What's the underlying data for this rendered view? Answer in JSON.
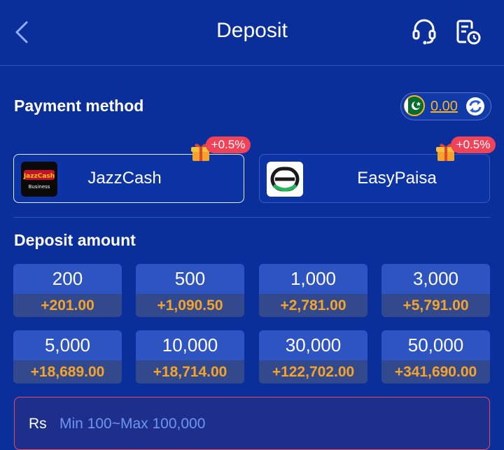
{
  "header": {
    "title": "Deposit",
    "icons": [
      "back-arrow-icon",
      "headset-icon",
      "history-icon"
    ]
  },
  "payment": {
    "label": "Payment method",
    "balance": "0.00",
    "flag_icon": "pakistan-flag-icon",
    "refresh_icon": "refresh-icon",
    "methods": [
      {
        "name": "JazzCash",
        "logo_text": "JazzCash",
        "logo_sub": "Business",
        "promo": "+0.5%",
        "selected": true
      },
      {
        "name": "EasyPaisa",
        "promo": "+0.5%",
        "selected": false
      }
    ]
  },
  "deposit": {
    "label": "Deposit amount",
    "amounts": [
      {
        "value": "200",
        "bonus": "+201.00"
      },
      {
        "value": "500",
        "bonus": "+1,090.50"
      },
      {
        "value": "1,000",
        "bonus": "+2,781.00"
      },
      {
        "value": "3,000",
        "bonus": "+5,791.00"
      },
      {
        "value": "5,000",
        "bonus": "+18,689.00"
      },
      {
        "value": "10,000",
        "bonus": "+18,714.00"
      },
      {
        "value": "30,000",
        "bonus": "+122,702.00"
      },
      {
        "value": "50,000",
        "bonus": "+341,690.00"
      }
    ],
    "currency": "Rs",
    "placeholder": "Min 100~Max 100,000"
  },
  "colors": {
    "background": "#0b2f9a",
    "accent_orange": "#f5a42a",
    "promo_red": "#f0435a",
    "input_border": "#e84a5f"
  }
}
